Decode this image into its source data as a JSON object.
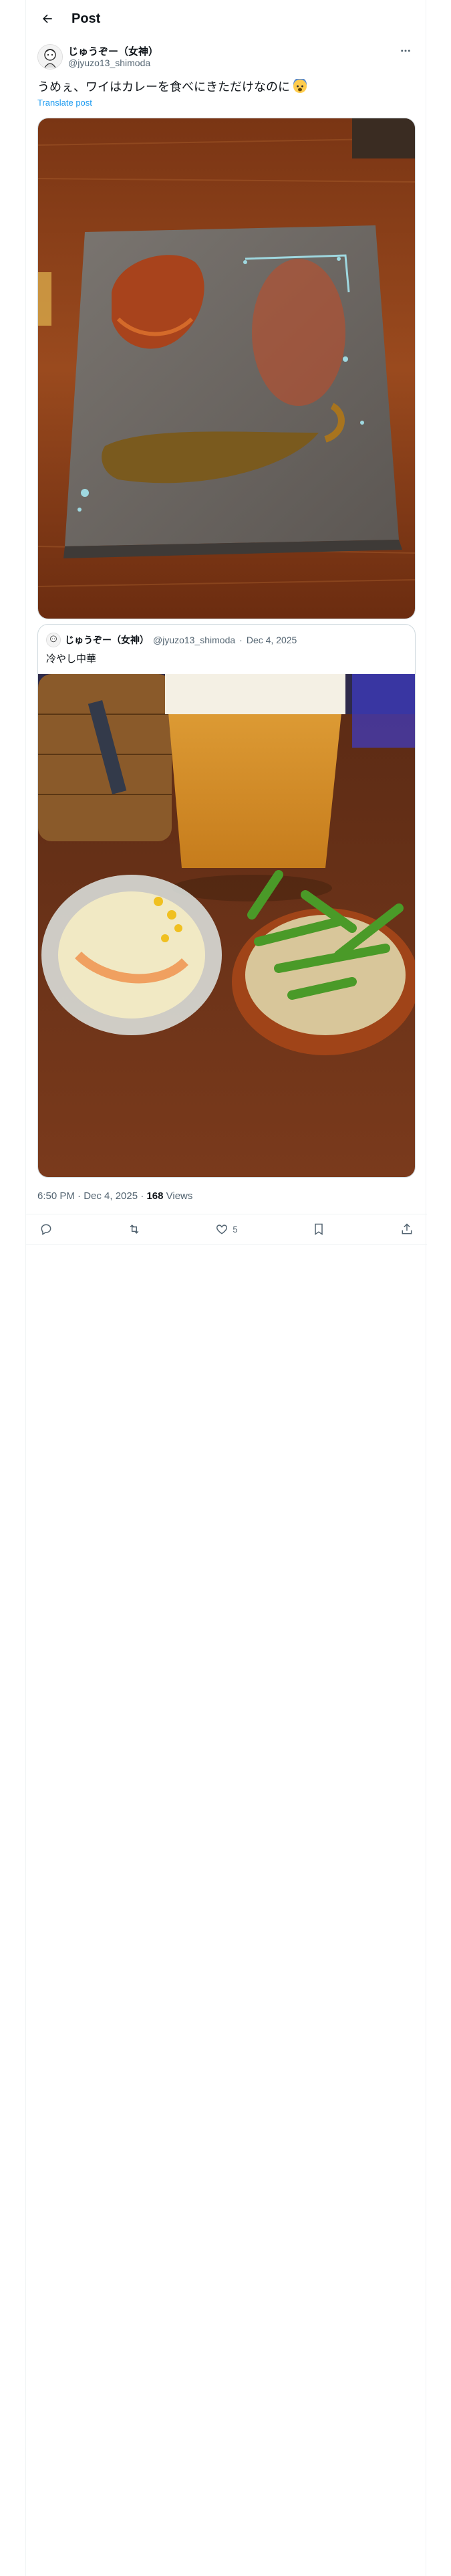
{
  "header": {
    "title": "Post"
  },
  "post": {
    "author_name": "じゅうぞー（女神）",
    "author_handle": "@jyuzo13_shimoda",
    "text": "うめぇ、ワイはカレーを食べにきただけなのに",
    "translate_label": "Translate post",
    "timestamp": "6:50 PM · Dec 4, 2025",
    "views_count": "168",
    "views_label": "Views"
  },
  "quote": {
    "author_name": "じゅうぞー（女神）",
    "author_handle": "@jyuzo13_shimoda",
    "date": "Dec 4, 2025",
    "separator": "·",
    "text": "冷やし中華"
  },
  "actions": {
    "likes_count": "5"
  },
  "icons": [
    "back-arrow-icon",
    "more-icon",
    "reply-icon",
    "repost-icon",
    "like-icon",
    "bookmark-icon",
    "share-icon",
    "fearful-face-emoji"
  ]
}
